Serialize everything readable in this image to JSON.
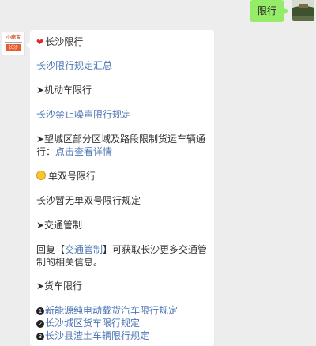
{
  "outgoing": {
    "text": "限行"
  },
  "bot_avatar": {
    "top_text": "小鹿宝",
    "city": "长沙"
  },
  "message": {
    "title": "长沙限行",
    "link_summary": "长沙限行规定汇总",
    "section_motor": "➤机动车限行",
    "link_noise": "长沙禁止噪声限行规定",
    "section_truck_area_prefix": "➤望城区部分区域及路段限制货运车辆通行：",
    "section_truck_area_link": "点击查看详情",
    "section_odd_even": "单双号限行",
    "odd_even_text": "长沙暂无单双号限行规定",
    "section_traffic": "➤交通管制",
    "traffic_reply_prefix": "回复【",
    "traffic_reply_link": "交通管制",
    "traffic_reply_suffix": "】可获取长沙更多交通管制的相关信息。",
    "section_trucks": "➤货车限行",
    "item1_num": "1",
    "item1": "新能源纯电动载货汽车限行规定",
    "item2_num": "2",
    "item2": "长沙城区货车限行规定",
    "item3_num": "3",
    "item3": "长沙县渣土车辆限行规定"
  }
}
